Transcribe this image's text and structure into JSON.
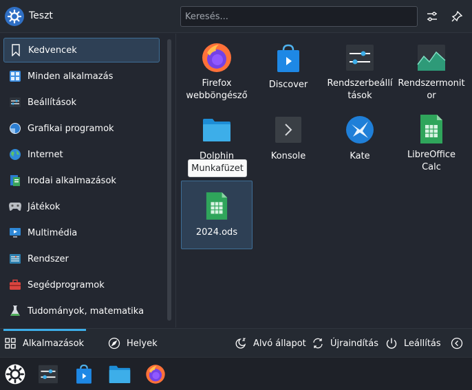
{
  "header": {
    "user_name": "Teszt",
    "search_placeholder": "Keresés...",
    "icons": {
      "user": "kde-logo-icon",
      "settings": "sliders-icon",
      "pin": "pin-icon"
    }
  },
  "sidebar": {
    "items": [
      {
        "label": "Kedvencek",
        "icon": "bookmark-icon",
        "active": true
      },
      {
        "label": "Minden alkalmazás",
        "icon": "grid-icon"
      },
      {
        "label": "Beállítások",
        "icon": "settings-icon"
      },
      {
        "label": "Grafikai programok",
        "icon": "graphics-icon"
      },
      {
        "label": "Internet",
        "icon": "globe-icon"
      },
      {
        "label": "Irodai alkalmazások",
        "icon": "office-icon"
      },
      {
        "label": "Játékok",
        "icon": "gamepad-icon"
      },
      {
        "label": "Multimédia",
        "icon": "multimedia-icon"
      },
      {
        "label": "Rendszer",
        "icon": "system-icon"
      },
      {
        "label": "Segédprogramok",
        "icon": "toolbox-icon"
      },
      {
        "label": "Tudományok, matematika",
        "icon": "flask-icon"
      }
    ]
  },
  "apps": [
    {
      "label": "Firefox webböngésző",
      "icon": "firefox-icon"
    },
    {
      "label": "Discover",
      "icon": "discover-icon"
    },
    {
      "label": "Rendszerbeállítások",
      "icon": "system-settings-icon"
    },
    {
      "label": "Rendszermonitor",
      "icon": "system-monitor-icon"
    },
    {
      "label": "Dolphin",
      "icon": "dolphin-folder-icon"
    },
    {
      "label": "Konsole",
      "icon": "konsole-icon"
    },
    {
      "label": "Kate",
      "icon": "kate-icon"
    },
    {
      "label": "LibreOffice Calc",
      "icon": "libreoffice-calc-icon"
    },
    {
      "label": "2024.ods",
      "icon": "spreadsheet-file-icon",
      "selected": true
    }
  ],
  "tooltip": {
    "text": "Munkafüzet"
  },
  "footer": {
    "tabs": [
      {
        "label": "Alkalmazások",
        "icon": "grid-icon",
        "active": true
      },
      {
        "label": "Helyek",
        "icon": "compass-icon"
      }
    ],
    "actions": [
      {
        "label": "Alvó állapot",
        "icon": "sleep-icon"
      },
      {
        "label": "Újraindítás",
        "icon": "restart-icon"
      },
      {
        "label": "Leállítás",
        "icon": "power-icon"
      }
    ]
  },
  "taskbar": {
    "items": [
      {
        "icon": "kde-launcher-icon"
      },
      {
        "icon": "system-settings-icon"
      },
      {
        "icon": "discover-icon"
      },
      {
        "icon": "dolphin-folder-icon"
      },
      {
        "icon": "firefox-icon"
      }
    ]
  },
  "colors": {
    "accent": "#3daee9",
    "background": "#232730",
    "selection": "#2e4055"
  }
}
